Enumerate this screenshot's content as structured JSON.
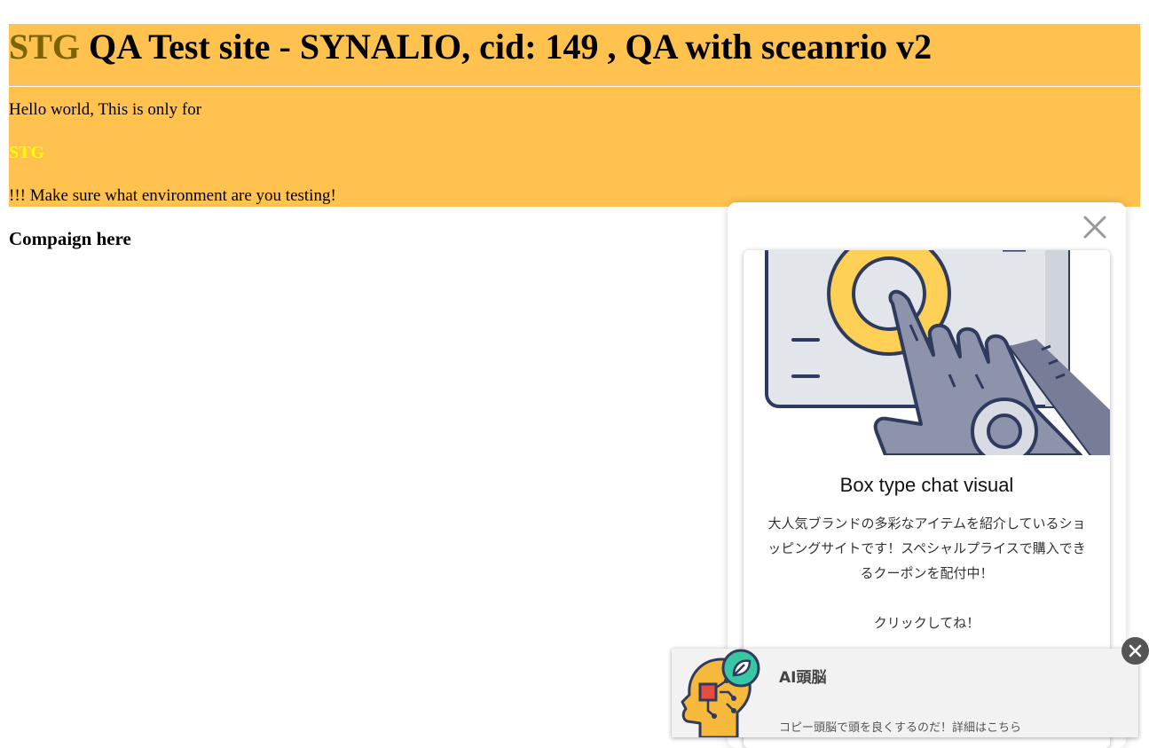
{
  "header": {
    "env_label": "STG",
    "title_rest": " QA Test site - SYNALIO, cid: 149 , QA with sceanrio v2"
  },
  "content": {
    "hello_text": "Hello world, This is only for",
    "env_highlight": "STG",
    "warning_text": "!!! Make sure what environment are you testing!",
    "campaign_heading": "Compaign here"
  },
  "chat_box": {
    "title": "Box type chat visual",
    "description": "大人気ブランドの多彩なアイテムを紹介しているショッピングサイトです！スペシャルプライスで購入できるクーポンを配付中！\n\nクリックしてね！",
    "close_icon": "close-icon"
  },
  "mini_chat": {
    "title": "AI頭脳",
    "text": "コピー頭脳で頭を良くするのだ！詳細はこちら",
    "icon": "ai-brain-icon",
    "close_icon": "close-circle-icon"
  },
  "colors": {
    "banner_bg": "#ffc24e",
    "env_label": "#7a6400",
    "env_highlight": "#ffff00"
  }
}
